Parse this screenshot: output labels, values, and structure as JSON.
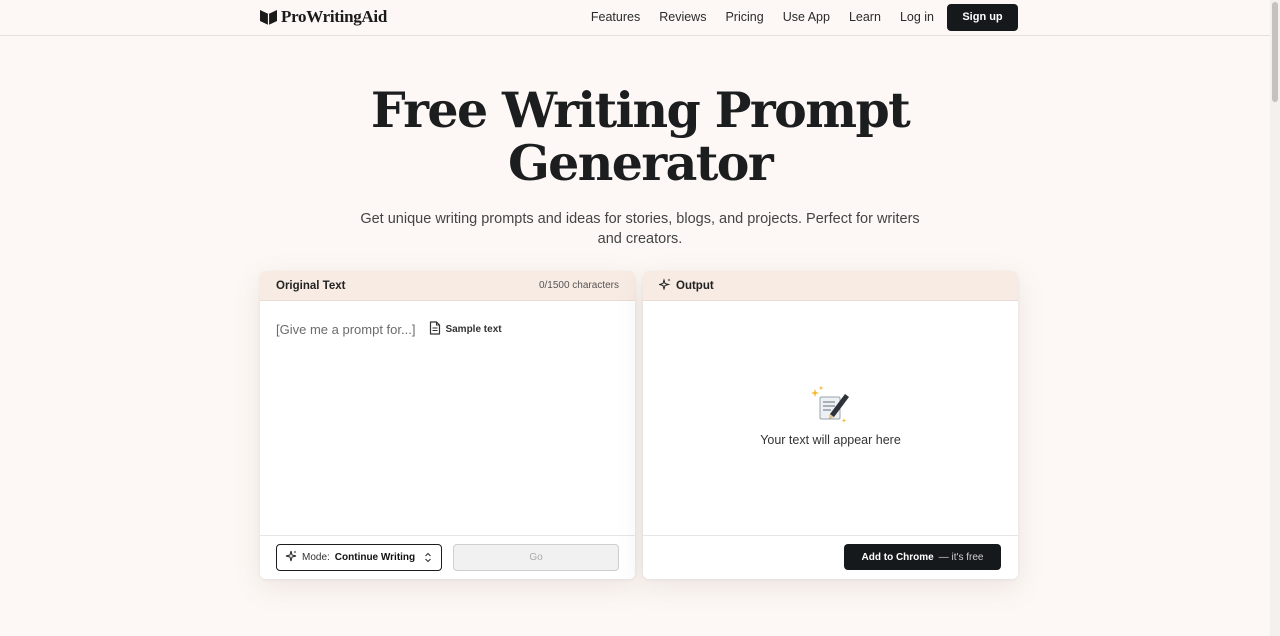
{
  "brand": {
    "name": "ProWritingAid"
  },
  "nav": {
    "items": [
      "Features",
      "Reviews",
      "Pricing",
      "Use App",
      "Learn",
      "Log in"
    ],
    "signup_label": "Sign up"
  },
  "hero": {
    "title_line1": "Free Writing Prompt",
    "title_line2": "Generator",
    "subtitle_line1": "Get unique writing prompts and ideas for stories, blogs, and projects. Perfect for writers",
    "subtitle_line2": "and creators."
  },
  "input_panel": {
    "title": "Original Text",
    "char_count": "0/1500 characters",
    "placeholder": "[Give me a prompt for...]",
    "sample_label": "Sample text",
    "mode_label": "Mode:",
    "mode_value": "Continue Writing",
    "go_label": "Go"
  },
  "output_panel": {
    "title": "Output",
    "empty_text": "Your text will appear here",
    "chrome_label": "Add to Chrome",
    "chrome_suffix": "— it's free"
  },
  "colors": {
    "background": "#fdf8f5",
    "panel_header": "#f7ebe4",
    "dark_button": "#16191b"
  },
  "icons": [
    "book-logo-icon",
    "document-icon",
    "sparkle-icon",
    "chevron-updown-icon",
    "writing-hand-icon",
    "sparkles-icon"
  ]
}
